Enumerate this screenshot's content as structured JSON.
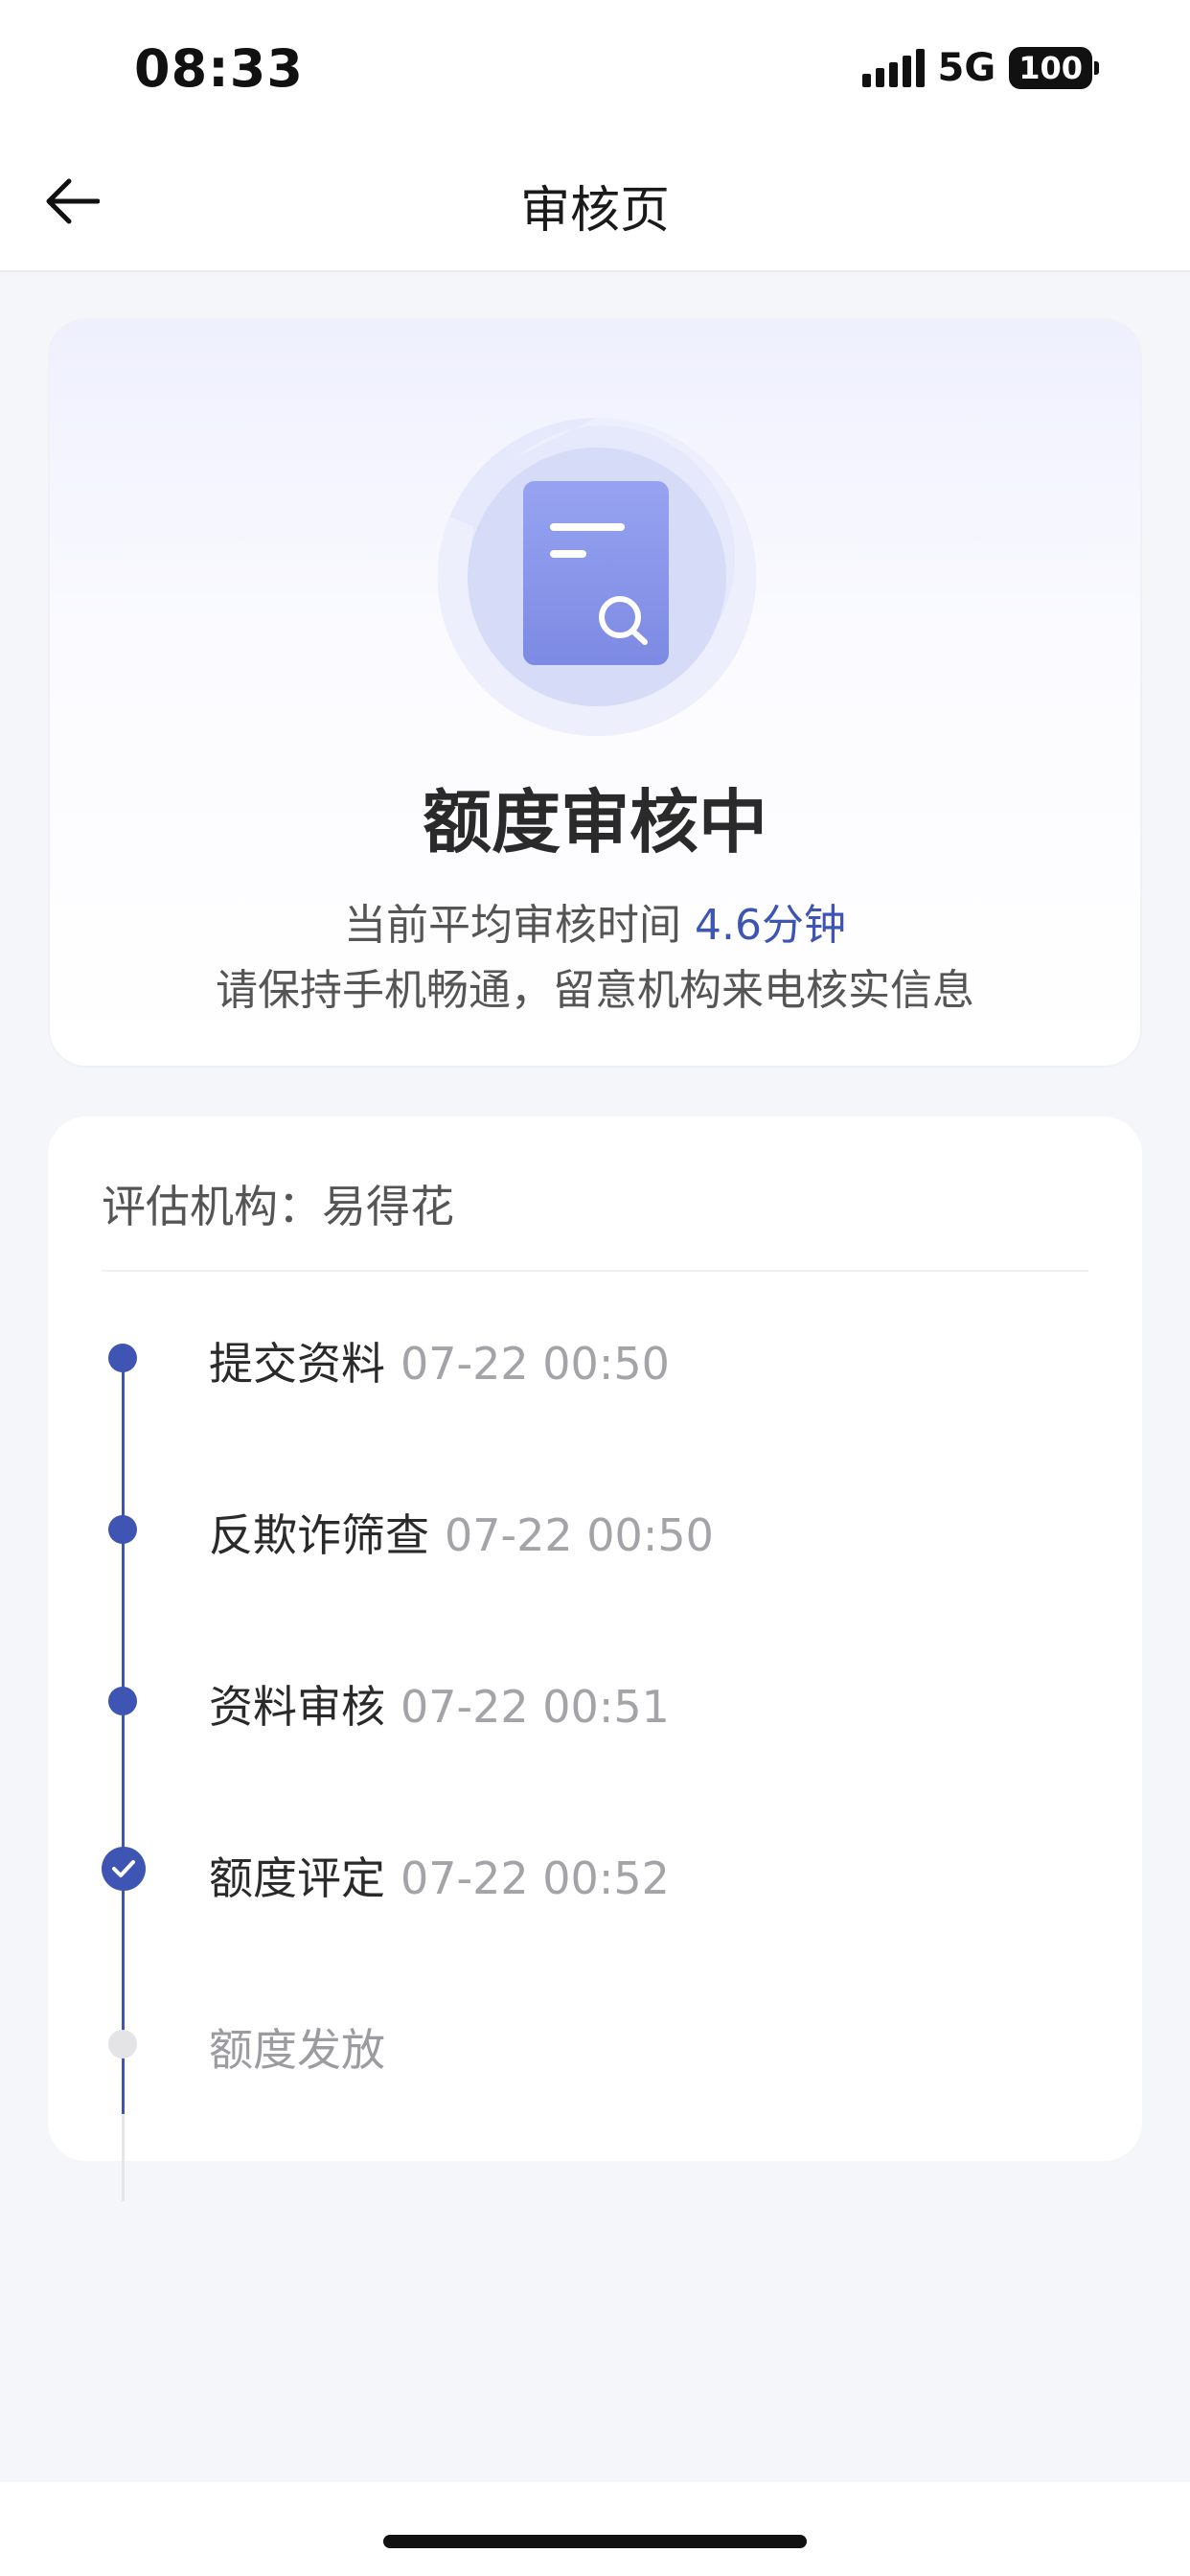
{
  "status_bar": {
    "time": "08:33",
    "network": "5G",
    "battery": "100",
    "signal_icon": "signal-bars-icon",
    "battery_icon": "battery-icon"
  },
  "nav": {
    "title": "审核页",
    "back_icon": "back-arrow-icon"
  },
  "status_card": {
    "illustration_icon": "document-search-icon",
    "title": "额度审核中",
    "avg_time_label": "当前平均审核时间",
    "avg_time_value": "4.6分钟",
    "notice": "请保持手机畅通，留意机构来电核实信息"
  },
  "progress": {
    "agency_label": "评估机构：",
    "agency_name": "易得花",
    "steps": [
      {
        "label": "提交资料",
        "time": "07-22 00:50",
        "state": "done"
      },
      {
        "label": "反欺诈筛查",
        "time": "07-22 00:50",
        "state": "done"
      },
      {
        "label": "资料审核",
        "time": "07-22 00:51",
        "state": "done"
      },
      {
        "label": "额度评定",
        "time": "07-22 00:52",
        "state": "current"
      },
      {
        "label": "额度发放",
        "time": "",
        "state": "pending"
      }
    ]
  },
  "colors": {
    "accent": "#3f55b3",
    "background": "#f5f6f9",
    "pending": "#e4e4e6"
  }
}
